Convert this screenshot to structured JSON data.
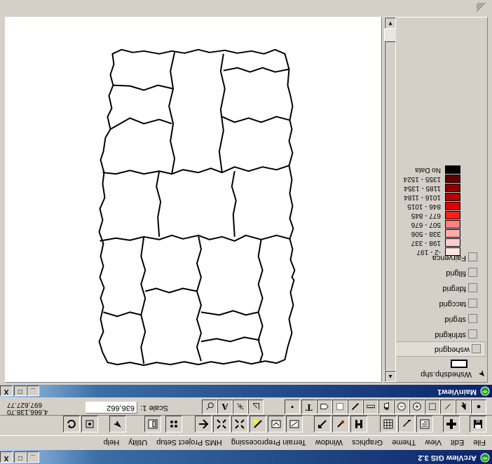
{
  "app": {
    "title": "ArcView GIS 3.2",
    "controls": {
      "minimize": "_",
      "maximize": "□",
      "close": "X"
    }
  },
  "menu": [
    "File",
    "Edit",
    "View",
    "Theme",
    "Graphics",
    "Window",
    "Terrain Preprocessing",
    "HMS Project Setup",
    "Utility",
    "Help"
  ],
  "toolbar_buttons": [
    "save-icon",
    "add-theme-icon",
    "theme-properties-icon",
    "edit-legend-icon",
    "open-table-icon",
    "find-icon",
    "locate-address-icon",
    "query-builder-icon",
    "zoom-to-extent-icon",
    "zoom-to-themes-icon",
    "zoom-to-selected-icon",
    "zoom-in-icon",
    "zoom-out-icon",
    "zoom-previous-icon",
    "select-by-theme-icon",
    "clear-selection-icon",
    "help-icon"
  ],
  "tools": [
    "identify-icon",
    "pointer-icon",
    "vertex-edit-icon",
    "select-feature-icon",
    "zoom-in-tool-icon",
    "zoom-out-tool-icon",
    "pan-icon",
    "measure-icon",
    "hotlink-icon",
    "area-of-interest-icon",
    "label-icon",
    "text-icon",
    "draw-point-icon",
    "snap-icon",
    "label-tool-icon",
    "text-tool-icon",
    "draw-tool-icon"
  ],
  "scale": {
    "label": "Scale 1:",
    "value": "636,662"
  },
  "coords": {
    "x": "4,666,138.70",
    "y": "697,627.77"
  },
  "view": {
    "title": "MainView1",
    "controls": {
      "minimize": "_",
      "maximize": "□",
      "close": "X"
    }
  },
  "toc": {
    "themes": [
      "Wshedshp.shp",
      "wsheqgrid",
      "strlnkgrid",
      "strgrid",
      "taccgrid",
      "fdirgrid",
      "fillgrid",
      "Fairvenca"
    ],
    "legend": [
      {
        "label": "-2 - 197",
        "color": "#ffe4e4"
      },
      {
        "label": "198 - 337",
        "color": "#ffcccc"
      },
      {
        "label": "338 - 506",
        "color": "#ffaaaa"
      },
      {
        "label": "507 - 676",
        "color": "#ff8080"
      },
      {
        "label": "677 - 845",
        "color": "#ff2020"
      },
      {
        "label": "846 - 1015",
        "color": "#e00000"
      },
      {
        "label": "1016 - 1184",
        "color": "#b40000"
      },
      {
        "label": "1185 - 1354",
        "color": "#8c0000"
      },
      {
        "label": "1355 - 1524",
        "color": "#600000"
      },
      {
        "label": "No Data",
        "color": "#000000"
      }
    ]
  }
}
